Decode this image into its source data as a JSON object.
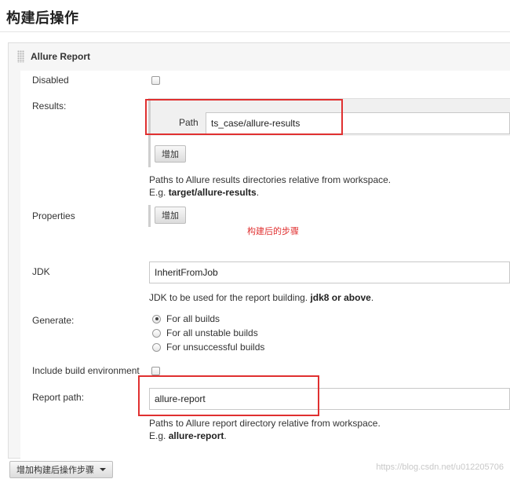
{
  "section_title": "构建后操作",
  "step": {
    "title": "Allure Report"
  },
  "disabled": {
    "label": "Disabled",
    "checked": false
  },
  "results": {
    "label": "Results:",
    "path_label": "Path",
    "path_value": "ts_case/allure-results",
    "add_button": "增加",
    "help_line1": "Paths to Allure results directories relative from workspace.",
    "help_prefix": "E.g. ",
    "help_example": "target/allure-results",
    "help_suffix": "."
  },
  "properties": {
    "label": "Properties",
    "add_button": "增加"
  },
  "annotation": "构建后的步骤",
  "jdk": {
    "label": "JDK",
    "value": "InheritFromJob",
    "help_prefix": "JDK to be used for the report building. ",
    "help_bold": "jdk8 or above",
    "help_suffix": "."
  },
  "generate": {
    "label": "Generate:",
    "options": [
      {
        "label": "For all builds",
        "checked": true
      },
      {
        "label": "For all unstable builds",
        "checked": false
      },
      {
        "label": "For unsuccessful builds",
        "checked": false
      }
    ]
  },
  "include_env": {
    "label": "Include build environment",
    "checked": false
  },
  "report_path": {
    "label": "Report path:",
    "value": "allure-report",
    "help_line1": "Paths to Allure report directory relative from workspace.",
    "help_prefix": "E.g. ",
    "help_example": "allure-report",
    "help_suffix": "."
  },
  "add_post_build_step": {
    "label": "增加构建后操作步骤",
    "icon": "caret-down-icon"
  },
  "watermark": "https://blog.csdn.net/u012205706",
  "colors": {
    "highlight": "#e03030",
    "panel_bg": "#f6f6f6"
  }
}
